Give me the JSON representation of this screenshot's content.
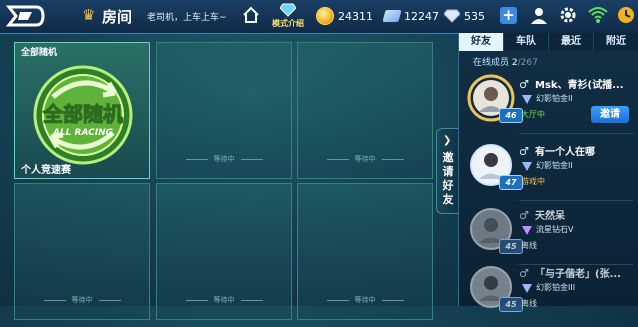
{
  "topbar": {
    "room_title": "房间",
    "room_desc": "老司机，上车上车~",
    "mode_label": "模式介绍",
    "coins": "24311",
    "coupons": "12247",
    "diamonds": "535"
  },
  "slots": {
    "main_title": "全部随机",
    "main_footer": "个人竞速赛",
    "emblem_text": "全部随机",
    "emblem_sub": "ALL RACING",
    "waiting": "等待中"
  },
  "invite": {
    "label": "邀请好友"
  },
  "panel": {
    "tabs": [
      "好友",
      "车队",
      "最近",
      "附近"
    ],
    "online_label": "在线成员",
    "online_count": "2",
    "online_total": "/267",
    "invite_button": "邀请",
    "members": [
      {
        "gender": "♂",
        "name": "Msk、青衫(试播...",
        "rank": "幻影铂金II",
        "level": "46",
        "status": "大厅中",
        "status_color": "#7dd64a",
        "online": true,
        "rank_color": "#9ab8ff"
      },
      {
        "gender": "♂",
        "name": "有一个人在哪",
        "rank": "幻影铂金II",
        "level": "47",
        "status": "游戏中",
        "status_color": "#f5c04a",
        "online": true,
        "rank_color": "#9ab8ff"
      },
      {
        "gender": "♂",
        "name": "天然呆",
        "rank": "流星钻石V",
        "level": "45",
        "status": "离线",
        "status_color": "#cfd8df",
        "online": false,
        "rank_color": "#c28cff"
      },
      {
        "gender": "♂",
        "name": "「与子偕老」(张...",
        "rank": "幻影铂金III",
        "level": "45",
        "status": "离线",
        "status_color": "#cfd8df",
        "online": false,
        "rank_color": "#9ab8ff"
      }
    ]
  }
}
